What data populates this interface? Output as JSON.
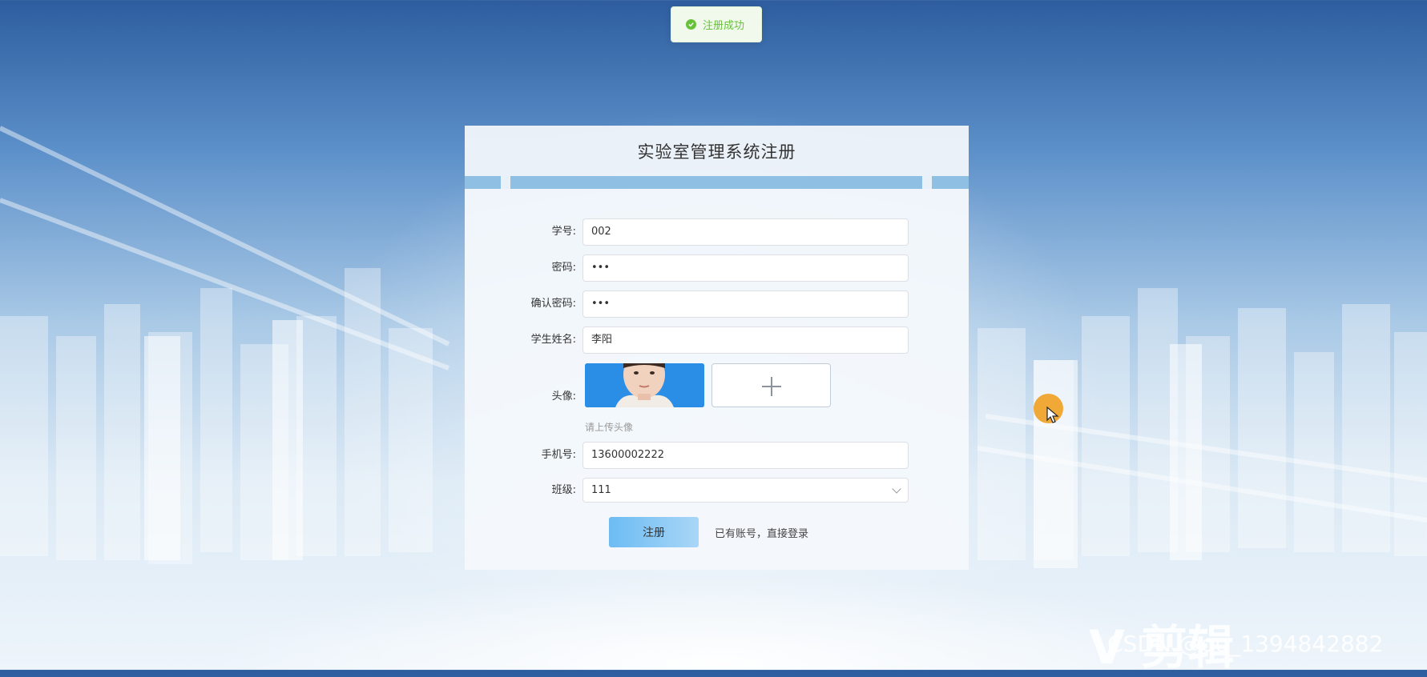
{
  "toast": {
    "message": "注册成功",
    "type": "success",
    "color": "#67c23a"
  },
  "form": {
    "title": "实验室管理系统注册",
    "fields": [
      {
        "label": "学号:",
        "value": "002"
      },
      {
        "label": "密码:",
        "value": "•••"
      },
      {
        "label": "确认密码:",
        "value": "•••"
      },
      {
        "label": "学生姓名:",
        "value": "李阳"
      }
    ],
    "avatar": {
      "label": "头像:",
      "hint": "请上传头像"
    },
    "phone": {
      "label": "手机号:",
      "value": "13600002222"
    },
    "class": {
      "label": "班级:",
      "value": "111"
    },
    "submit_label": "注册",
    "login_link": "已有账号，直接登录"
  },
  "watermark": {
    "logo_text": "V 剪辑",
    "csdn_text": "CSDN @qq_1394842882"
  },
  "colors": {
    "accent": "#67c23a",
    "button": "#6cbcf3"
  }
}
